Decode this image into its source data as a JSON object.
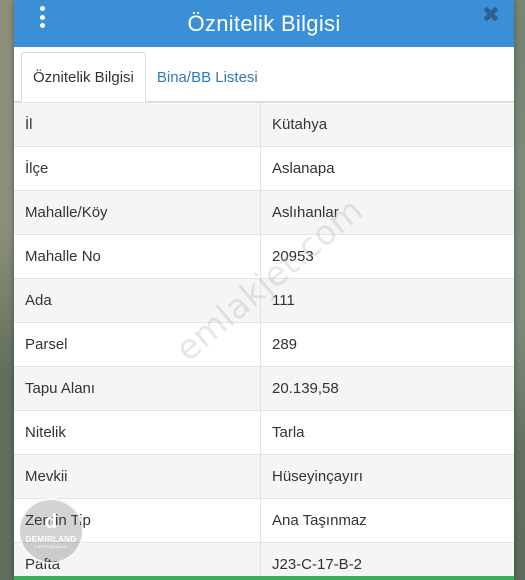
{
  "dialog": {
    "title": "Öznitelik Bilgisi",
    "close_icon": "✖"
  },
  "tabs": [
    {
      "label": "Öznitelik Bilgisi",
      "active": true
    },
    {
      "label": "Bina/BB Listesi",
      "active": false
    }
  ],
  "attributes": [
    {
      "key": "İl",
      "value": "Kütahya"
    },
    {
      "key": "İlçe",
      "value": "Aslanapa"
    },
    {
      "key": "Mahalle/Köy",
      "value": "Aslıhanlar"
    },
    {
      "key": "Mahalle No",
      "value": "20953"
    },
    {
      "key": "Ada",
      "value": "111"
    },
    {
      "key": "Parsel",
      "value": "289"
    },
    {
      "key": "Tapu Alanı",
      "value": "20.139,58"
    },
    {
      "key": "Nitelik",
      "value": "Tarla"
    },
    {
      "key": "Mevkii",
      "value": "Hüseyinçayırı"
    },
    {
      "key": "Zemin Tip",
      "value": "Ana Taşınmaz"
    },
    {
      "key": "Pafta",
      "value": "J23-C-17-B-2"
    }
  ],
  "watermark": "emlakjet.com",
  "logo": {
    "mark": "d",
    "name": "DEMIRLAND",
    "sub": "GAYRİMENKUL"
  },
  "colors": {
    "titlebar": "#3b8fd6",
    "tab_link": "#2f7ab8",
    "bottom_bar": "#3fae5a"
  }
}
